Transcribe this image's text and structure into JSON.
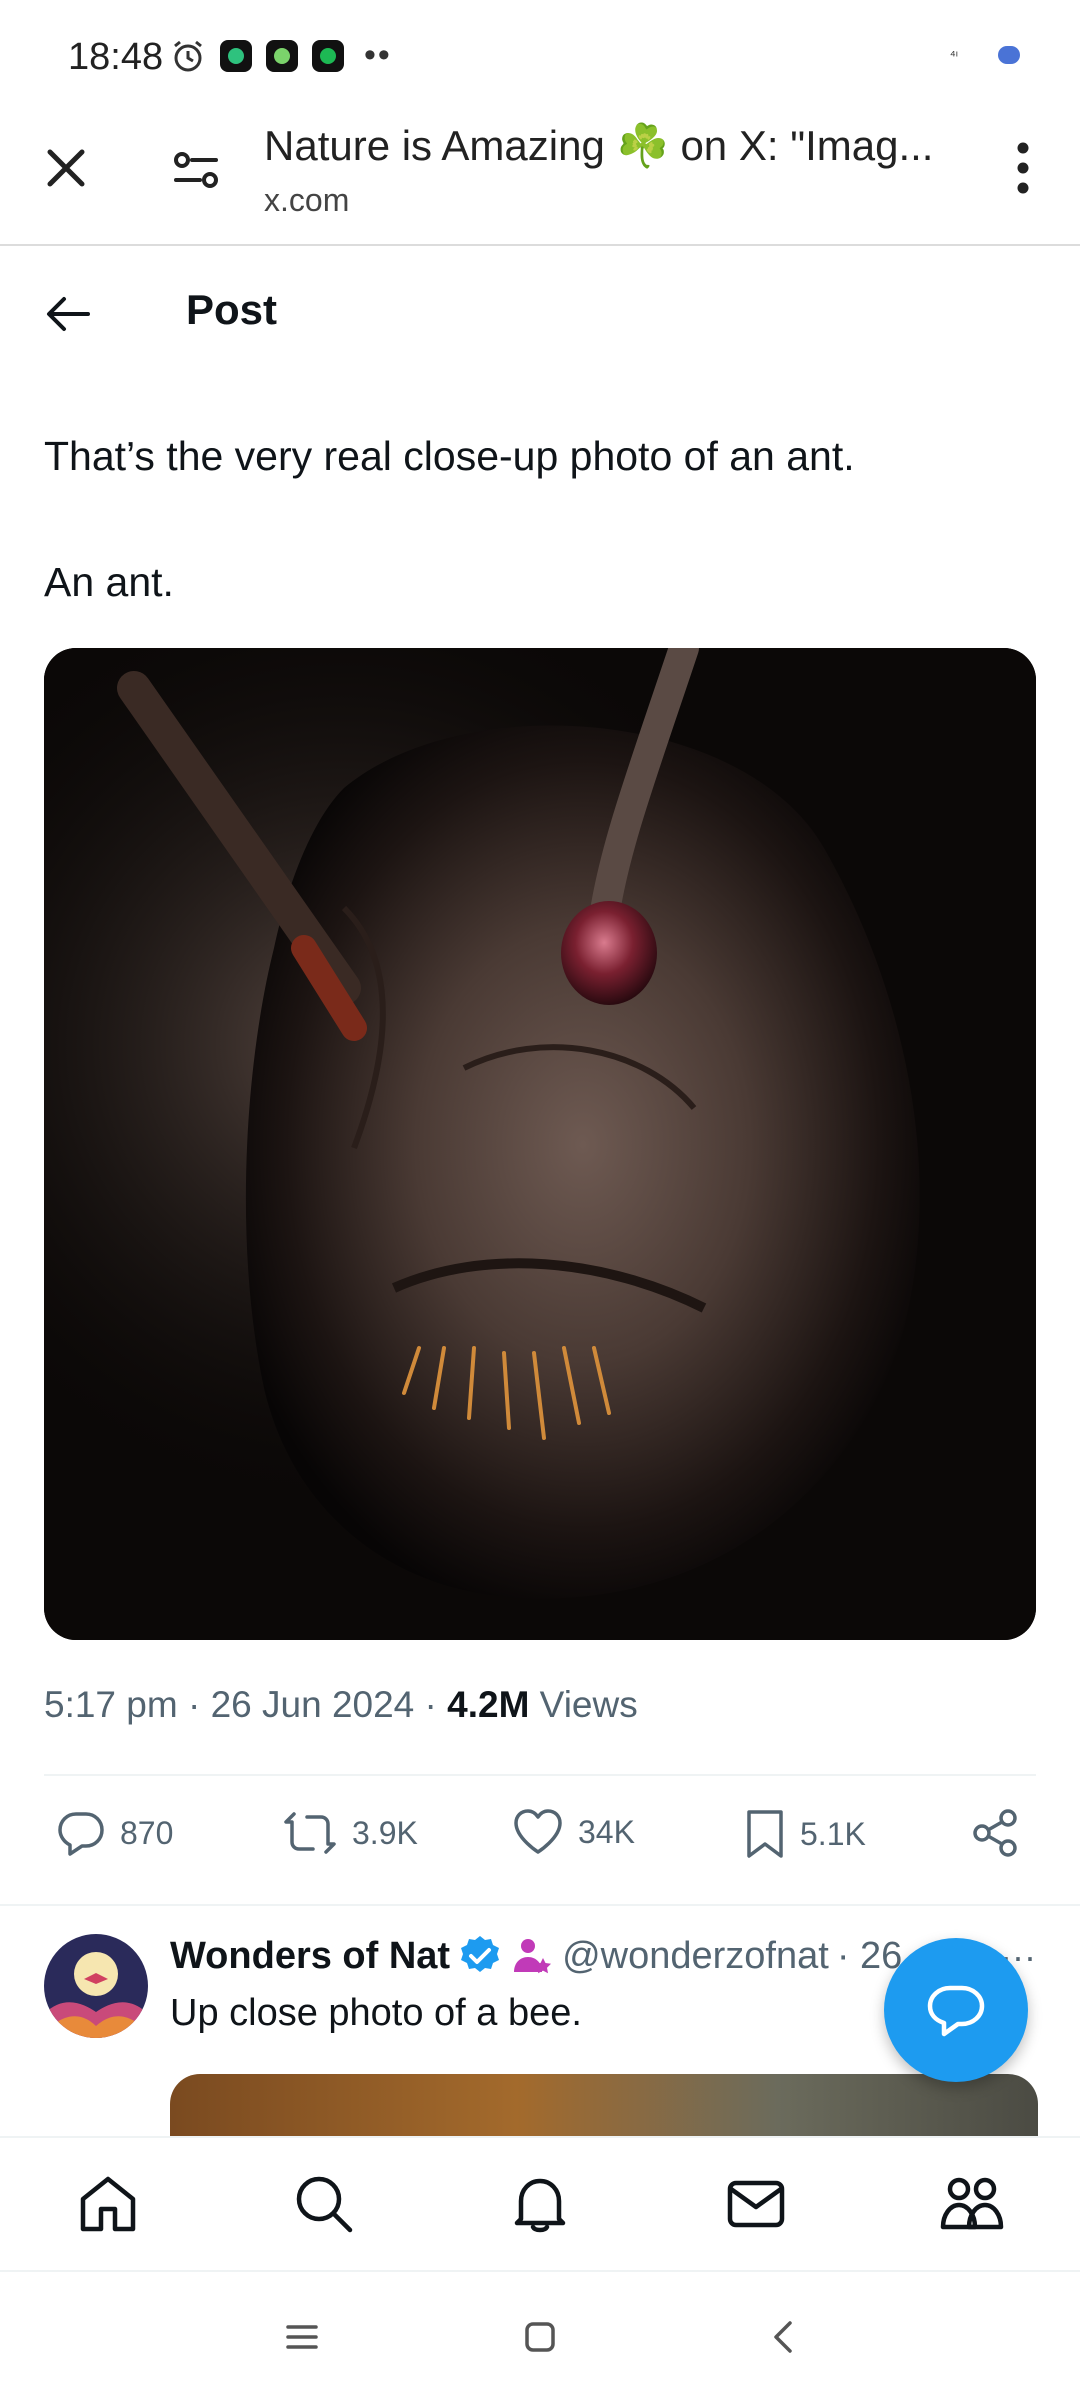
{
  "status_bar": {
    "time": "18:48",
    "overflow_dots": "••",
    "signal_text": "⁴ᶦ"
  },
  "browser": {
    "page_title": "Nature is Amazing ☘️ on X: \"Imag...",
    "url": "x.com"
  },
  "post_header": {
    "title": "Post"
  },
  "tweet": {
    "text_line_1": "That’s the very real close-up photo of an ant.",
    "text_line_2": "An ant.",
    "meta_time": "5:17 pm · 26 Jun 2024 · ",
    "views_count": "4.2M",
    "views_label": " Views",
    "replies": "870",
    "reposts": "3.9K",
    "likes": "34K",
    "bookmarks": "5.1K"
  },
  "reply": {
    "name": "Wonders of Nat",
    "handle": "@wonderzofnat",
    "time": "· 26",
    "text": "Up close photo of a bee.",
    "more": "···"
  },
  "colors": {
    "accent": "#1d9bf0",
    "secondary_text": "#536471",
    "primary_text": "#0f1419"
  },
  "icons": {
    "status": [
      "alarm-icon",
      "app-icon",
      "app-icon",
      "spotify-icon",
      "battery-icon"
    ],
    "browser": [
      "close-icon",
      "tune-icon",
      "more-vert-icon"
    ],
    "actions": [
      "reply-icon",
      "repost-icon",
      "like-icon",
      "bookmark-icon",
      "share-icon"
    ],
    "nav": [
      "home-icon",
      "search-icon",
      "notifications-icon",
      "messages-icon",
      "communities-icon"
    ],
    "system": [
      "recents-icon",
      "home-button-icon",
      "back-icon"
    ]
  }
}
